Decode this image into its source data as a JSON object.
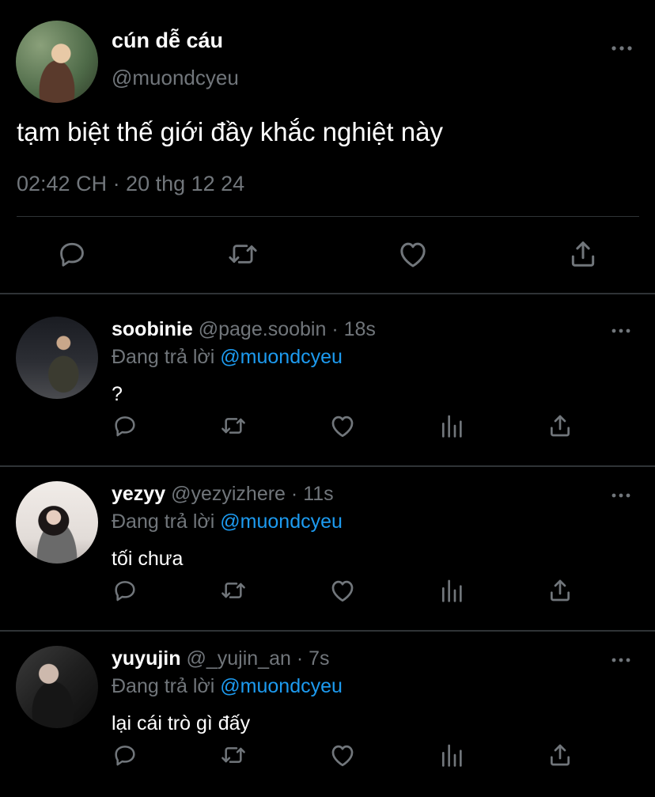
{
  "main_tweet": {
    "display_name": "cún dễ cáu",
    "handle": "@muondcyeu",
    "text": "tạm biệt thế giới đầy khắc nghiệt này",
    "timestamp": "02:42 CH · 20 thg 12 24",
    "actions": [
      "reply-icon",
      "retweet-icon",
      "like-icon",
      "share-icon"
    ]
  },
  "replies": [
    {
      "display_name": "soobinie",
      "handle": "@page.soobin",
      "separator": "·",
      "time": "18s",
      "replying_prefix": "Đang trả lời",
      "replying_to": "@muondcyeu",
      "text": "?"
    },
    {
      "display_name": "yezyy",
      "handle": "@yezyizhere",
      "separator": "·",
      "time": "11s",
      "replying_prefix": "Đang trả lời",
      "replying_to": "@muondcyeu",
      "text": "tối chưa"
    },
    {
      "display_name": "yuyujin",
      "handle": "@_yujin_an",
      "separator": "·",
      "time": "7s",
      "replying_prefix": "Đang trả lời",
      "replying_to": "@muondcyeu",
      "text": "lại cái trò gì đấy"
    }
  ],
  "reply_actions": [
    "reply-icon",
    "retweet-icon",
    "like-icon",
    "views-icon",
    "share-icon"
  ],
  "colors": {
    "background": "#000000",
    "text": "#e7e9ea",
    "muted": "#71767b",
    "link": "#1d9bf0",
    "divider": "#2f3336"
  }
}
